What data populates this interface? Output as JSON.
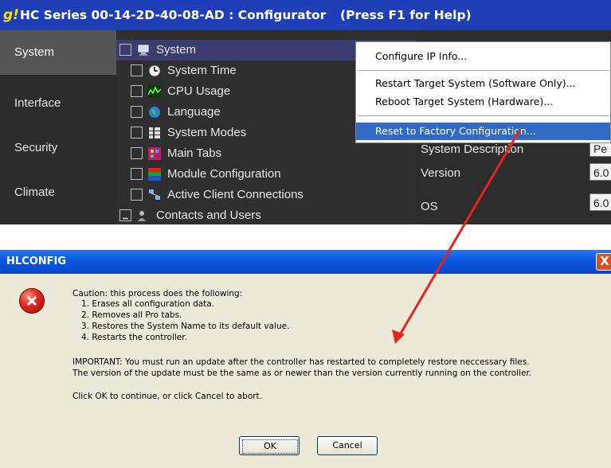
{
  "configurator": {
    "logo": "g!",
    "title": "HC Series 00-14-2D-40-08-AD : Configurator",
    "help_hint": "(Press F1 for Help)",
    "nav": [
      {
        "label": "System",
        "active": true
      },
      {
        "label": "Interface",
        "active": false
      },
      {
        "label": "Security",
        "active": false
      },
      {
        "label": "Climate",
        "active": false
      }
    ],
    "tree": [
      {
        "label": "System",
        "icon": "computer-icon",
        "selected": true
      },
      {
        "label": "System Time",
        "icon": "clock-icon"
      },
      {
        "label": "CPU Usage",
        "icon": "cpu-graph-icon"
      },
      {
        "label": "Language",
        "icon": "globe-icon"
      },
      {
        "label": "System Modes",
        "icon": "modes-icon"
      },
      {
        "label": "Main Tabs",
        "icon": "tabs-icon"
      },
      {
        "label": "Module Configuration",
        "icon": "module-icon"
      },
      {
        "label": "Active Client Connections",
        "icon": "network-icon"
      },
      {
        "label": "Contacts and Users",
        "icon": "users-icon"
      }
    ],
    "properties": [
      {
        "label": "System Description",
        "value": "Pe"
      },
      {
        "label": "Version",
        "value": "6.0"
      },
      {
        "label": "OS",
        "value": "6.0"
      }
    ],
    "context_menu": {
      "items": [
        "Configure IP Info...",
        "Restart Target System (Software Only)...",
        "Reboot Target System (Hardware)...",
        "Reset to Factory Configuration..."
      ],
      "highlighted_index": 3
    }
  },
  "dialog": {
    "title": "HLCONFIG",
    "close_label": "X",
    "caution": "Caution: this process does the following:",
    "steps": [
      "1. Erases all configuration data.",
      "2. Removes all Pro tabs.",
      "3. Restores the System Name to its default value.",
      "4. Restarts the controller."
    ],
    "important_1": "IMPORTANT: You must run an update after the controller has restarted to completely restore neccessary files.",
    "important_2": "The version of the update must be the same as or newer than the version currently running on the controller.",
    "instruction": "Click OK to continue, or click Cancel to abort.",
    "ok_label": "OK",
    "cancel_label": "Cancel"
  },
  "colors": {
    "configurator_title_bg": "#1f3fb6",
    "menu_highlight": "#316ac5",
    "arrow": "#e8231c",
    "dialog_bg": "#ece9d8"
  }
}
